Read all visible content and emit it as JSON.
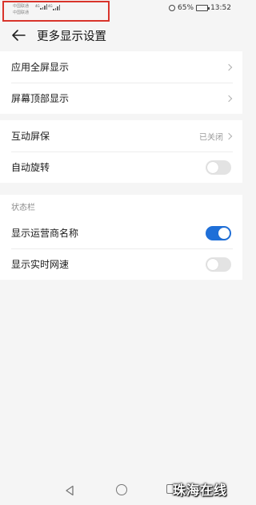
{
  "status_bar": {
    "carrier_1": "中国联通",
    "carrier_2": "中国联通",
    "network_1": "4G",
    "network_2": "4G",
    "battery": "65%",
    "time": "13:52"
  },
  "header": {
    "title": "更多显示设置"
  },
  "group_display": {
    "items": [
      {
        "label": "应用全屏显示"
      },
      {
        "label": "屏幕顶部显示"
      }
    ]
  },
  "group_screen": {
    "items": [
      {
        "label": "互动屏保",
        "value": "已关闭"
      },
      {
        "label": "自动旋转",
        "toggle": false
      }
    ]
  },
  "group_status": {
    "section_title": "状态栏",
    "items": [
      {
        "label": "显示运营商名称",
        "toggle": true
      },
      {
        "label": "显示实时网速",
        "toggle": false
      }
    ]
  },
  "watermark": "珠海在线",
  "colors": {
    "accent": "#1f6fd8",
    "highlight_box": "#d9342b",
    "background": "#f5f5f5"
  }
}
